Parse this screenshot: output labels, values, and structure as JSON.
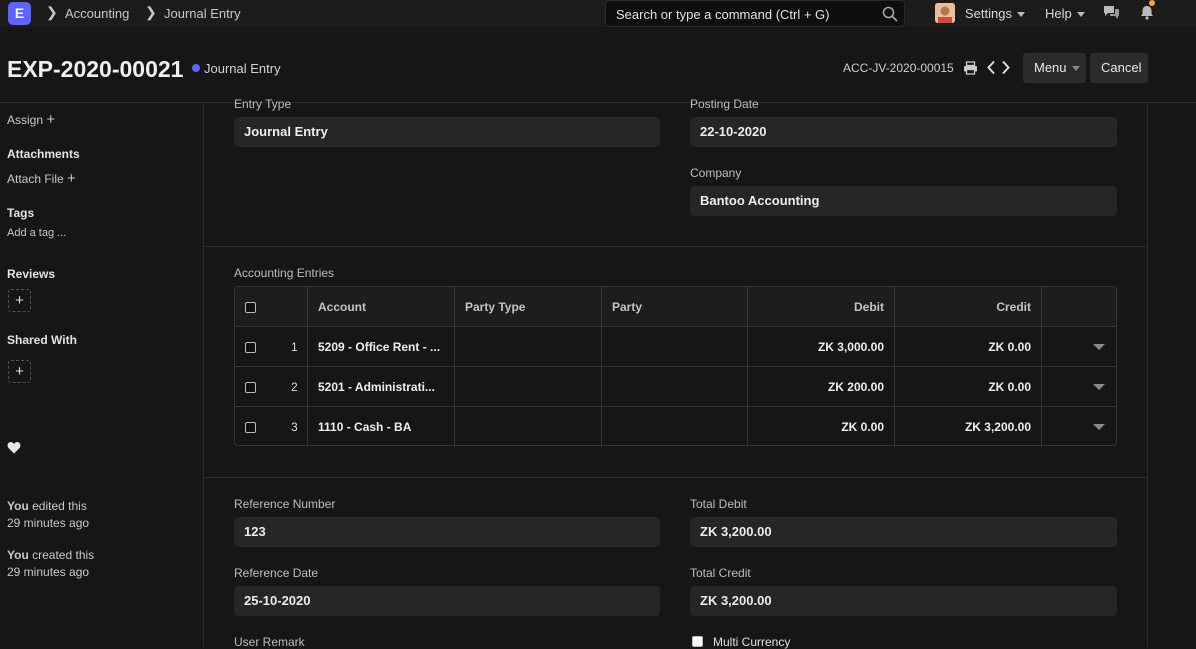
{
  "navbar": {
    "logo_letter": "E",
    "breadcrumbs": [
      "Accounting",
      "Journal Entry"
    ],
    "search_placeholder": "Search or type a command (Ctrl + G)",
    "settings_label": "Settings",
    "help_label": "Help",
    "accent": "#5e64ff"
  },
  "header": {
    "title": "EXP-2020-00021",
    "status": "Journal Entry",
    "doc_ref": "ACC-JV-2020-00015",
    "menu_label": "Menu",
    "cancel_label": "Cancel"
  },
  "sidebar": {
    "assign_label": "Assign",
    "attachments_title": "Attachments",
    "attach_file_label": "Attach File",
    "tags_title": "Tags",
    "add_tag_label": "Add a tag ...",
    "reviews_title": "Reviews",
    "shared_with_title": "Shared With",
    "activity": [
      {
        "actor": "You",
        "action": "edited this",
        "time": "29 minutes ago"
      },
      {
        "actor": "You",
        "action": "created this",
        "time": "29 minutes ago"
      }
    ]
  },
  "form": {
    "entry_type_label": "Entry Type",
    "entry_type_value": "Journal Entry",
    "posting_date_label": "Posting Date",
    "posting_date_value": "22-10-2020",
    "company_label": "Company",
    "company_value": "Bantoo Accounting",
    "accounts_label": "Accounting Entries",
    "accounts_table": {
      "columns": [
        "Account",
        "Party Type",
        "Party",
        "Debit",
        "Credit"
      ],
      "rows": [
        {
          "idx": "1",
          "account": "5209 - Office Rent - ...",
          "party_type": "",
          "party": "",
          "debit": "ZK 3,000.00",
          "credit": "ZK 0.00"
        },
        {
          "idx": "2",
          "account": "5201 - Administrati...",
          "party_type": "",
          "party": "",
          "debit": "ZK 200.00",
          "credit": "ZK 0.00"
        },
        {
          "idx": "3",
          "account": "1110 - Cash - BA",
          "party_type": "",
          "party": "",
          "debit": "ZK 0.00",
          "credit": "ZK 3,200.00"
        }
      ]
    },
    "reference_number_label": "Reference Number",
    "reference_number_value": "123",
    "total_debit_label": "Total Debit",
    "total_debit_value": "ZK 3,200.00",
    "reference_date_label": "Reference Date",
    "reference_date_value": "25-10-2020",
    "total_credit_label": "Total Credit",
    "total_credit_value": "ZK 3,200.00",
    "user_remark_label": "User Remark",
    "multi_currency_label": "Multi Currency"
  }
}
